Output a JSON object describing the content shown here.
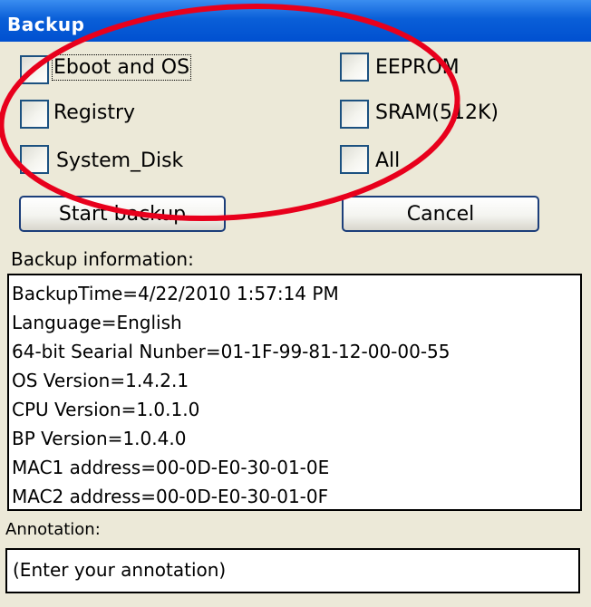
{
  "window": {
    "title": "Backup"
  },
  "options": {
    "eboot_os": "Eboot and OS",
    "eeprom": "EEPROM",
    "registry": "Registry",
    "sram": "SRAM(512K)",
    "system_disk": "System_Disk",
    "all": "All"
  },
  "buttons": {
    "start": "Start backup",
    "cancel": "Cancel"
  },
  "backup_info": {
    "label": "Backup information:",
    "lines": [
      "BackupTime=4/22/2010 1:57:14 PM",
      "Language=English",
      "64-bit Searial Nunber=01-1F-99-81-12-00-00-55",
      "OS Version=1.4.2.1",
      "CPU Version=1.0.1.0",
      "BP Version=1.0.4.0",
      "MAC1 address=00-0D-E0-30-01-0E",
      "MAC2 address=00-0D-E0-30-01-0F"
    ]
  },
  "annotation": {
    "label": "Annotation:",
    "placeholder": "(Enter your annotation)"
  },
  "colors": {
    "titlebar": "#0a5fd8",
    "window_bg": "#ece9d8",
    "highlight_ellipse": "#e8001c"
  }
}
